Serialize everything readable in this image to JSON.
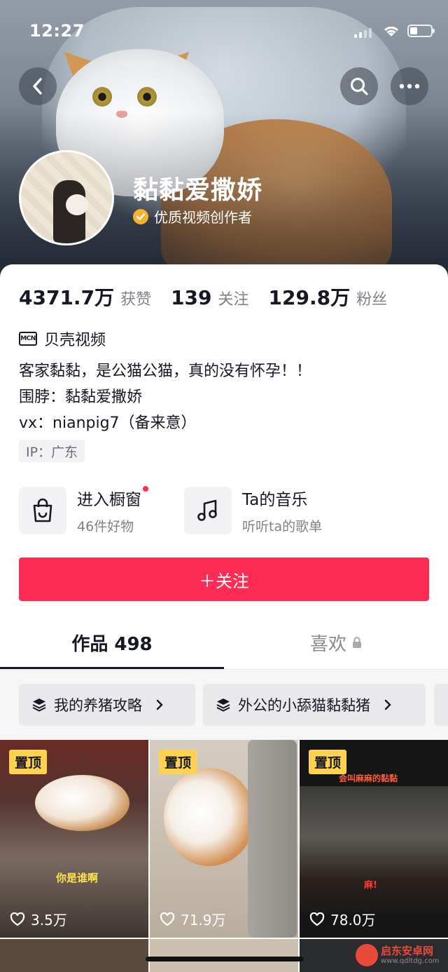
{
  "status_bar": {
    "time": "12:27"
  },
  "profile": {
    "nickname": "黏黏爱撒娇",
    "certification": "优质视频创作者"
  },
  "stats": [
    {
      "value": "4371.7万",
      "label": "获赞"
    },
    {
      "value": "139",
      "label": "关注"
    },
    {
      "value": "129.8万",
      "label": "粉丝"
    }
  ],
  "mcn": {
    "icon_text": "MCN",
    "label": "贝壳视频"
  },
  "bio": [
    "客家黏黏，是公猫公猫，真的没有怀孕！！",
    "围脖：黏黏爱撒娇",
    "vx：nianpig7（备来意）"
  ],
  "ip": "IP：广东",
  "entries": {
    "shop": {
      "title": "进入橱窗",
      "subtitle": "46件好物",
      "icon": "shopping-bag-icon"
    },
    "music": {
      "title": "Ta的音乐",
      "subtitle": "听听ta的歌单",
      "icon": "music-note-icon"
    }
  },
  "follow_button": {
    "label": "＋关注"
  },
  "tabs": {
    "works": "作品 498",
    "likes": "喜欢"
  },
  "collections": [
    {
      "label": "我的养猪攻略"
    },
    {
      "label": "外公的小舔猫黏黏猪"
    }
  ],
  "videos": [
    {
      "pinned_label": "置顶",
      "likes": "3.5万",
      "caption": "你是谁啊"
    },
    {
      "pinned_label": "置顶",
      "likes": "71.9万"
    },
    {
      "pinned_label": "置顶",
      "likes": "78.0万",
      "caption": "会叫麻麻的黏黏",
      "caption2": "麻!"
    }
  ],
  "watermark": {
    "title": "启东安卓网",
    "url": "www.qdltdg.com"
  },
  "colors": {
    "accent": "#fe2c55",
    "pin": "#fed14f",
    "verified": "#f4b22e"
  }
}
